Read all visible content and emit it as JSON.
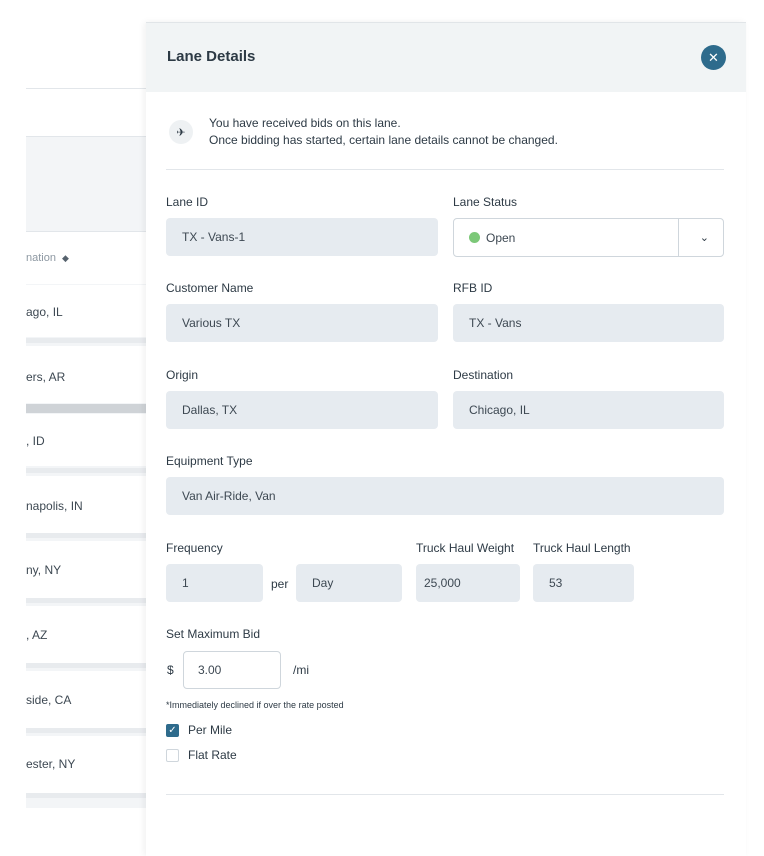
{
  "background_table": {
    "header_label": "nation",
    "sort_icon": "sort-icon",
    "rows": [
      "ago, IL",
      "ers, AR",
      ", ID",
      "napolis, IN",
      "ny, NY",
      ", AZ",
      "side, CA",
      "ester, NY"
    ]
  },
  "drawer": {
    "title": "Lane Details",
    "close_icon": "close-icon",
    "notice": {
      "icon": "satellite-icon",
      "line1": "You have received bids on this lane.",
      "line2": "Once bidding has started, certain lane details cannot be changed."
    },
    "lane_id": {
      "label": "Lane ID",
      "value": "TX - Vans-1"
    },
    "lane_status": {
      "label": "Lane Status",
      "value": "Open",
      "status_color": "#7cc878"
    },
    "customer_name": {
      "label": "Customer Name",
      "value": "Various TX"
    },
    "rfb_id": {
      "label": "RFB ID",
      "value": "TX - Vans"
    },
    "origin": {
      "label": "Origin",
      "value": "Dallas, TX"
    },
    "destination": {
      "label": "Destination",
      "value": "Chicago, IL"
    },
    "equipment_type": {
      "label": "Equipment Type",
      "value": "Van Air-Ride, Van"
    },
    "frequency": {
      "label": "Frequency",
      "value": "1",
      "per": "per",
      "unit": "Day"
    },
    "truck_haul_weight": {
      "label": "Truck Haul Weight",
      "value": "25,000"
    },
    "truck_haul_length": {
      "label": "Truck Haul Length",
      "value": "53"
    },
    "max_bid": {
      "label": "Set Maximum Bid",
      "currency": "$",
      "value": "3.00",
      "unit": "/mi",
      "note": "*Immediately declined if over the rate posted"
    },
    "options": [
      {
        "label": "Per Mile",
        "checked": true
      },
      {
        "label": "Flat Rate",
        "checked": false
      }
    ]
  },
  "colors": {
    "accent": "#2e6b8c",
    "field_bg": "#e6ebf0",
    "header_bg": "#f1f4f5"
  }
}
